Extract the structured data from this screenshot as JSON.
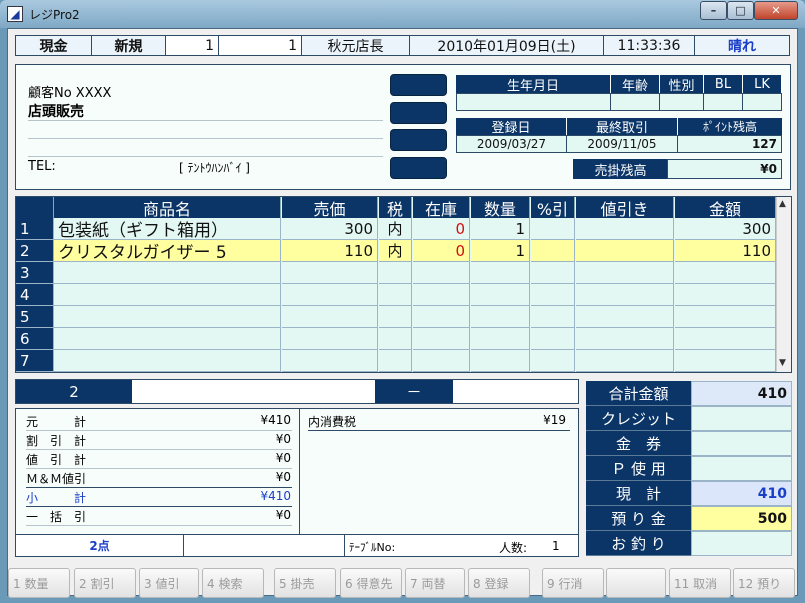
{
  "window": {
    "title": "レジPro2",
    "app_icon": "app-logo-icon",
    "controls": {
      "minimize": "–",
      "maximize": "□",
      "close": "✕"
    }
  },
  "header": {
    "mode": "現金",
    "type": "新規",
    "field1": "1",
    "field2": "1",
    "staff": "秋元店長",
    "date": "2010年01月09日(土)",
    "time": "11:33:36",
    "weather": "晴れ"
  },
  "customer": {
    "number": "顧客No XXXX",
    "name": "店頭販売",
    "tel_label": "TEL:",
    "tel_note": "[ ﾃﾝﾄｳﾊﾝﾊﾞｲ ]"
  },
  "info": {
    "row1_headers": [
      "生年月日",
      "年齢",
      "性別",
      "BL",
      "LK"
    ],
    "row1_values": [
      "",
      "",
      "",
      "",
      ""
    ],
    "row2_headers": [
      "登録日",
      "最終取引",
      "ﾎﾟｲﾝﾄ残高"
    ],
    "row2_values": [
      "2009/03/27",
      "2009/11/05",
      "127"
    ],
    "ar_label": "売掛残高",
    "ar_value": "¥0"
  },
  "table": {
    "headers": [
      "",
      "商品名",
      "売価",
      "税",
      "在庫",
      "数量",
      "%引",
      "値引き",
      "金額"
    ],
    "rows": [
      {
        "no": "1",
        "name": "包装紙（ギフト箱用）",
        "price": "300",
        "tax": "内",
        "stock": "0",
        "qty": "1",
        "pct": "",
        "disc": "",
        "amount": "300"
      },
      {
        "no": "2",
        "name": "クリスタルガイザー 5",
        "price": "110",
        "tax": "内",
        "stock": "0",
        "qty": "1",
        "pct": "",
        "disc": "",
        "amount": "110"
      },
      {
        "no": "3",
        "name": "",
        "price": "",
        "tax": "",
        "stock": "",
        "qty": "",
        "pct": "",
        "disc": "",
        "amount": ""
      },
      {
        "no": "4",
        "name": "",
        "price": "",
        "tax": "",
        "stock": "",
        "qty": "",
        "pct": "",
        "disc": "",
        "amount": ""
      },
      {
        "no": "5",
        "name": "",
        "price": "",
        "tax": "",
        "stock": "",
        "qty": "",
        "pct": "",
        "disc": "",
        "amount": ""
      },
      {
        "no": "6",
        "name": "",
        "price": "",
        "tax": "",
        "stock": "",
        "qty": "",
        "pct": "",
        "disc": "",
        "amount": ""
      },
      {
        "no": "7",
        "name": "",
        "price": "",
        "tax": "",
        "stock": "",
        "qty": "",
        "pct": "",
        "disc": "",
        "amount": ""
      }
    ],
    "selected_row": 2,
    "stock_color": "#d01010"
  },
  "entry": {
    "code": "2",
    "name": "",
    "dash": "－",
    "value": ""
  },
  "summary": {
    "items": [
      {
        "label": "元　　　計",
        "value": "¥410"
      },
      {
        "label": "割　引　計",
        "value": "¥0"
      },
      {
        "label": "値　引　計",
        "value": "¥0"
      },
      {
        "label": "Ｍ＆Ｍ値引",
        "value": "¥0"
      },
      {
        "label": "小　　　計",
        "value": "¥410",
        "highlight": true
      },
      {
        "label": "一　括　引",
        "value": "¥0"
      }
    ],
    "tax_label": "内消費税",
    "tax_value": "¥19",
    "count": "2点",
    "table_no_label": "ﾃｰﾌﾞﾙNo:",
    "people_label": "人数:",
    "people_value": "1"
  },
  "totals": [
    {
      "label": "合計金額",
      "value": "410"
    },
    {
      "label": "クレジット",
      "value": ""
    },
    {
      "label": "金　券",
      "value": ""
    },
    {
      "label": "Ｐ 使 用",
      "value": ""
    },
    {
      "label": "現　計",
      "value": "410"
    },
    {
      "label": "預 り 金",
      "value": "500"
    },
    {
      "label": "お 釣 り",
      "value": ""
    }
  ],
  "fkeys": [
    "1 数量",
    "2 割引",
    "3 値引",
    "4 検索",
    "5 掛売",
    "6 得意先",
    "7 両替",
    "8 登録",
    "9 行消",
    "",
    "11 取消",
    "12 預り"
  ],
  "colors": {
    "dark": "#0b3567",
    "light": "#e3f7f3",
    "yellow": "#ffffa0",
    "accent_text": "#1a3ec8"
  }
}
